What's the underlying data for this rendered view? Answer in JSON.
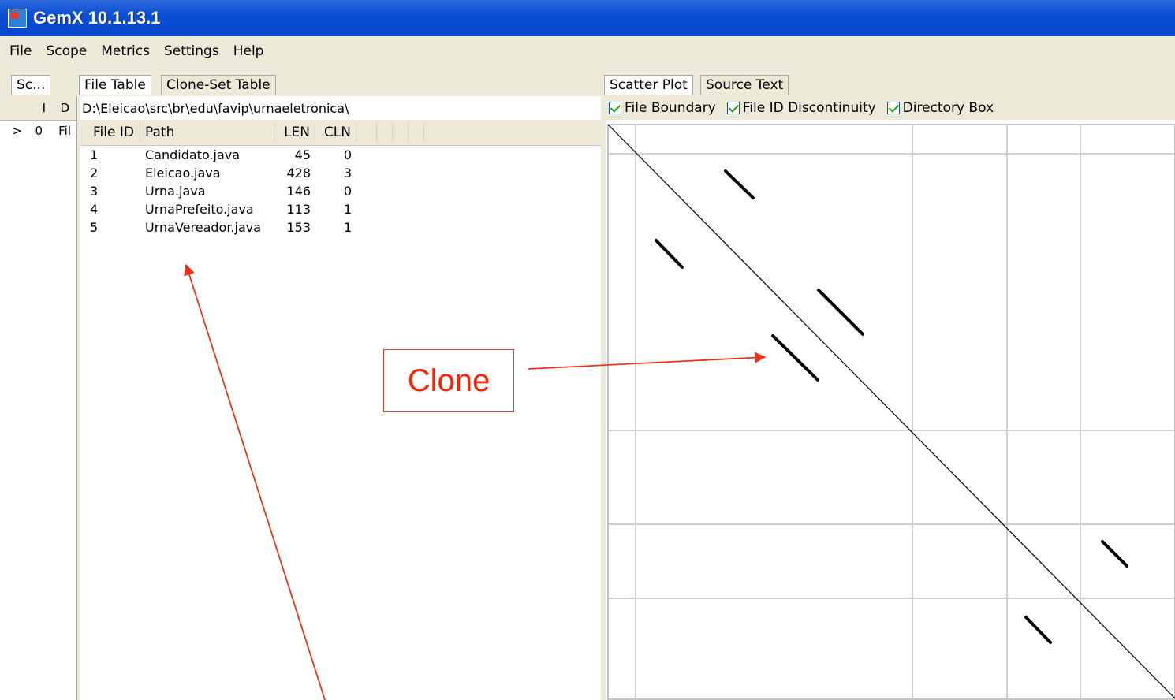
{
  "window": {
    "title": "GemX 10.1.13.1"
  },
  "menu": [
    "File",
    "Scope",
    "Metrics",
    "Settings",
    "Help"
  ],
  "left_panel": {
    "tab": "Sc...",
    "headers": [
      "I",
      "D"
    ],
    "row": [
      ">",
      "0",
      "Fil"
    ]
  },
  "file_table": {
    "tabs": [
      "File Table",
      "Clone-Set Table"
    ],
    "path": "D:\\Eleicao\\src\\br\\edu\\favip\\urnaeletronica\\",
    "columns": [
      "File ID",
      "Path",
      "LEN",
      "CLN"
    ],
    "rows": [
      {
        "id": "1",
        "path": "Candidato.java",
        "len": "45",
        "cln": "0"
      },
      {
        "id": "2",
        "path": "Eleicao.java",
        "len": "428",
        "cln": "3"
      },
      {
        "id": "3",
        "path": "Urna.java",
        "len": "146",
        "cln": "0"
      },
      {
        "id": "4",
        "path": "UrnaPrefeito.java",
        "len": "113",
        "cln": "1"
      },
      {
        "id": "5",
        "path": "UrnaVereador.java",
        "len": "153",
        "cln": "1"
      }
    ]
  },
  "scatter": {
    "tabs": [
      "Scatter Plot",
      "Source Text"
    ],
    "options": [
      {
        "label": "File Boundary",
        "checked": true
      },
      {
        "label": "File ID Discontinuity",
        "checked": true
      },
      {
        "label": "Directory Box",
        "checked": true
      }
    ]
  },
  "annotation": {
    "label": "Clone",
    "color": "#ff2200"
  }
}
